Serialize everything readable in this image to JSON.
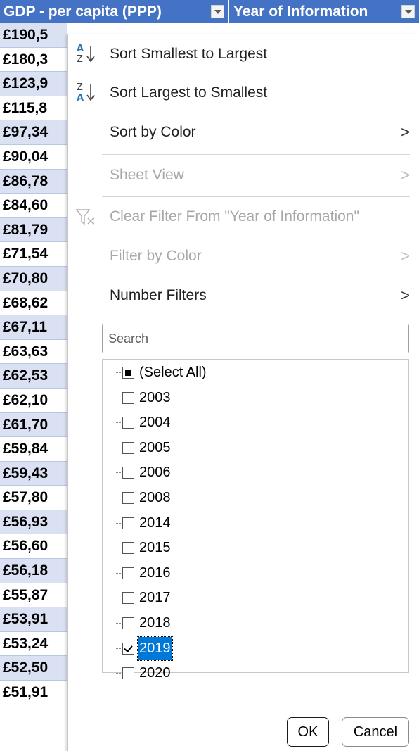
{
  "header": {
    "gdp_title": "GDP - per capita (PPP)",
    "year_title": "Year of Information"
  },
  "gdp_column": [
    "£190,5",
    "£180,3",
    "£123,9",
    "£115,8",
    "£97,34",
    "£90,04",
    "£86,78",
    "£84,60",
    "£81,79",
    "£71,54",
    "£70,80",
    "£68,62",
    "£67,11",
    "£63,63",
    "£62,53",
    "£62,10",
    "£61,70",
    "£59,84",
    "£59,43",
    "£57,80",
    "£56,93",
    "£56,60",
    "£56,18",
    "£55,87",
    "£53,91",
    "£53,24",
    "£52,50",
    "£51,91"
  ],
  "menu": {
    "sort_asc": "Sort Smallest to Largest",
    "sort_desc": "Sort Largest to Smallest",
    "sort_color": "Sort by Color",
    "sheet_view": "Sheet View",
    "clear_filter": "Clear Filter From \"Year of Information\"",
    "filter_color": "Filter by Color",
    "number_filters": "Number Filters",
    "submenu_arrow": ">"
  },
  "search": {
    "placeholder": "Search"
  },
  "list": {
    "select_all": "(Select All)",
    "items": [
      "2003",
      "2004",
      "2005",
      "2006",
      "2008",
      "2014",
      "2015",
      "2016",
      "2017",
      "2018",
      "2019",
      "2020"
    ],
    "checked": [
      "2019"
    ]
  },
  "buttons": {
    "ok": "OK",
    "cancel": "Cancel"
  },
  "icons": {
    "sort_asc": "sort-ascending-icon",
    "sort_desc": "sort-descending-icon",
    "clear_filter": "clear-filter-icon",
    "dropdown": "dropdown-arrow-icon"
  },
  "colors": {
    "header_bg": "#4472c4",
    "row_alt": "#d9e1f2",
    "selection": "#0078d7",
    "sort_icon_blue": "#2e75b6"
  }
}
